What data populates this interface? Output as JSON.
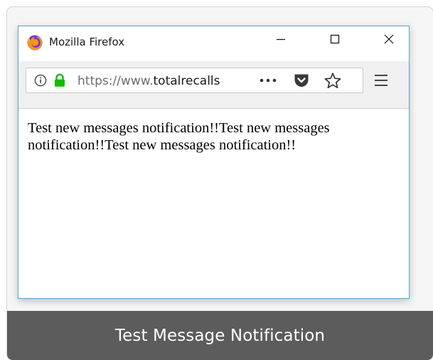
{
  "window": {
    "title": "Mozilla Firefox",
    "controls": {
      "minimize_icon": "minimize-icon",
      "maximize_icon": "maximize-icon",
      "close_icon": "close-icon"
    }
  },
  "navbar": {
    "url_prefix": "https://www.",
    "url_domain": "totalrecalls",
    "icons": [
      "info-icon",
      "lock-icon",
      "more-icon",
      "pocket-icon",
      "star-icon",
      "menu-icon"
    ]
  },
  "content": {
    "message": "Test new messages notification!!Test new messages notification!!Test new messages notification!!"
  },
  "caption": {
    "text": "Test Message Notification"
  },
  "colors": {
    "window_border": "#5aa5c9",
    "lock_green": "#12bc00",
    "caption_bg": "#5c5c5c",
    "toolbar_bg": "#f0f0f0"
  }
}
